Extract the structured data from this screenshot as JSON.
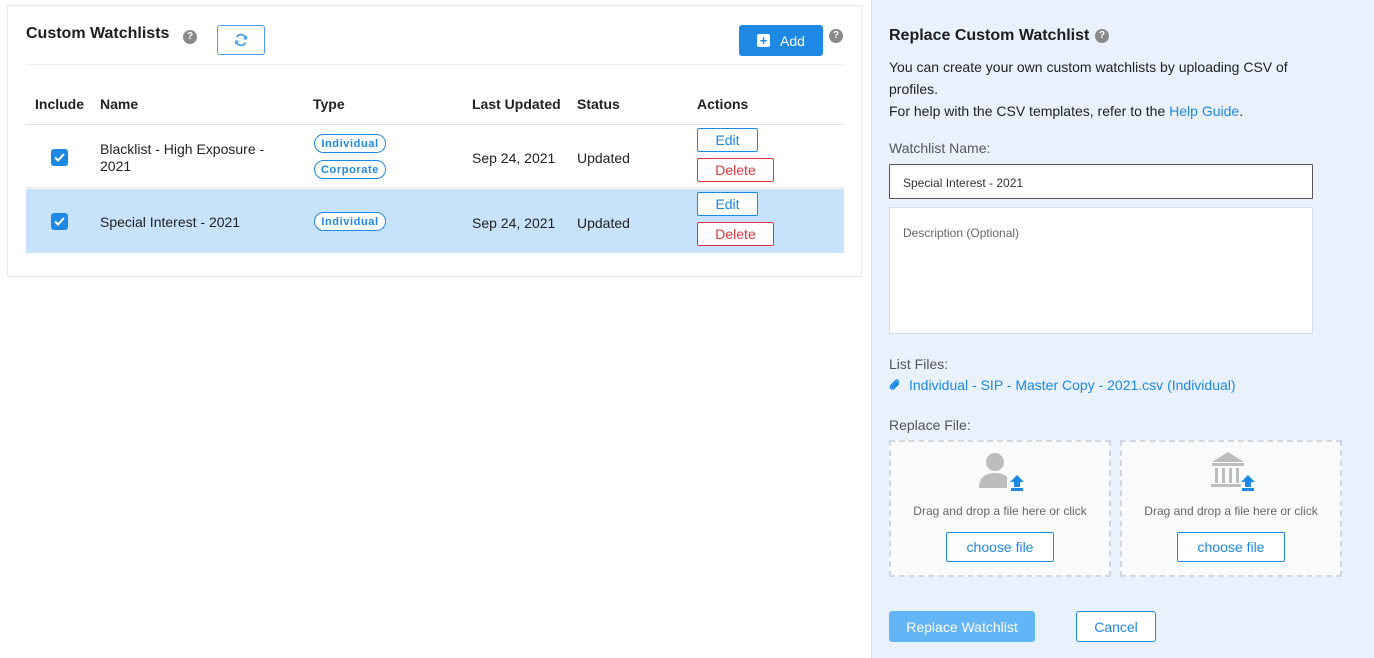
{
  "watchlists_panel": {
    "title": "Custom Watchlists",
    "add_label": "Add",
    "columns": [
      "Include",
      "Name",
      "Type",
      "Last Updated",
      "Status",
      "Actions"
    ],
    "rows": [
      {
        "included": true,
        "name": "Blacklist - High Exposure - 2021",
        "types": [
          "Individual",
          "Corporate"
        ],
        "last_updated": "Sep 24, 2021",
        "status": "Updated",
        "edit_label": "Edit",
        "delete_label": "Delete",
        "selected": false
      },
      {
        "included": true,
        "name": "Special Interest - 2021",
        "types": [
          "Individual"
        ],
        "last_updated": "Sep 24, 2021",
        "status": "Updated",
        "edit_label": "Edit",
        "delete_label": "Delete",
        "selected": true
      }
    ]
  },
  "replace_panel": {
    "title": "Replace Custom Watchlist",
    "intro_line1": "You can create your own custom watchlists by uploading CSV of",
    "intro_line2": "profiles.",
    "help_prefix": "For help with the CSV templates, refer to the ",
    "help_link": "Help Guide",
    "help_suffix": ".",
    "name_label": "Watchlist Name:",
    "name_value": "Special Interest - 2021",
    "description_placeholder": "Description (Optional)",
    "list_files_label": "List Files:",
    "file_name": "Individual - SIP - Master Copy - 2021.csv (Individual)",
    "replace_file_label": "Replace File:",
    "dropzones": [
      {
        "icon": "person-upload-icon",
        "text": "Drag and drop a file here or click",
        "button": "choose file"
      },
      {
        "icon": "building-upload-icon",
        "text": "Drag and drop a file here or click",
        "button": "choose file"
      }
    ],
    "replace_button": "Replace Watchlist",
    "cancel_button": "Cancel"
  },
  "colors": {
    "accent": "#1e88e5",
    "danger": "#e0353d",
    "selected_row": "#c7e2fb",
    "panel_bg": "#e8f1fc"
  }
}
